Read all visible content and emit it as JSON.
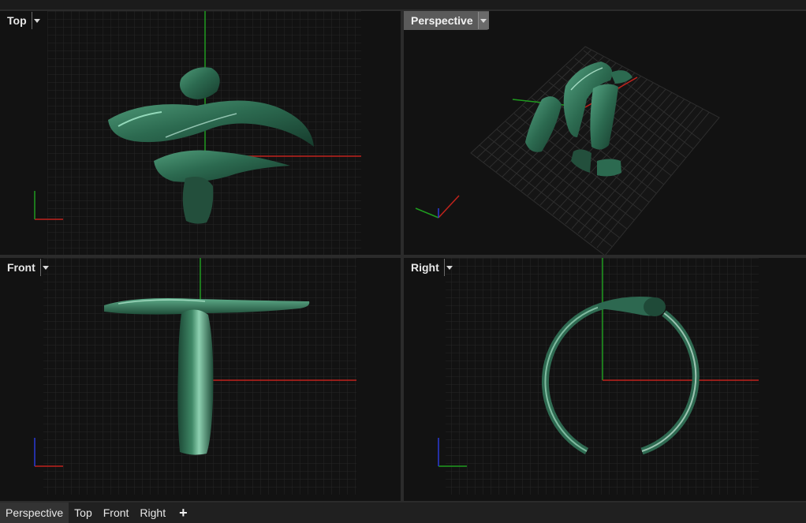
{
  "viewports": {
    "top": {
      "title": "Top"
    },
    "perspective": {
      "title": "Perspective"
    },
    "front": {
      "title": "Front"
    },
    "right": {
      "title": "Right"
    }
  },
  "tabs": [
    {
      "label": "Perspective",
      "active": true
    },
    {
      "label": "Top",
      "active": false
    },
    {
      "label": "Front",
      "active": false
    },
    {
      "label": "Right",
      "active": false
    }
  ],
  "add_tab_label": "+",
  "colors": {
    "x_axis": "#c0231c",
    "y_axis": "#1f9b1f",
    "z_axis": "#2a3bd6",
    "model": "#2f6b52",
    "grid": "#2b2b2b",
    "viewport_bg": "#121212"
  },
  "icons": {
    "viewport_menu": "chevron-down-icon",
    "add_tab": "plus-icon"
  }
}
